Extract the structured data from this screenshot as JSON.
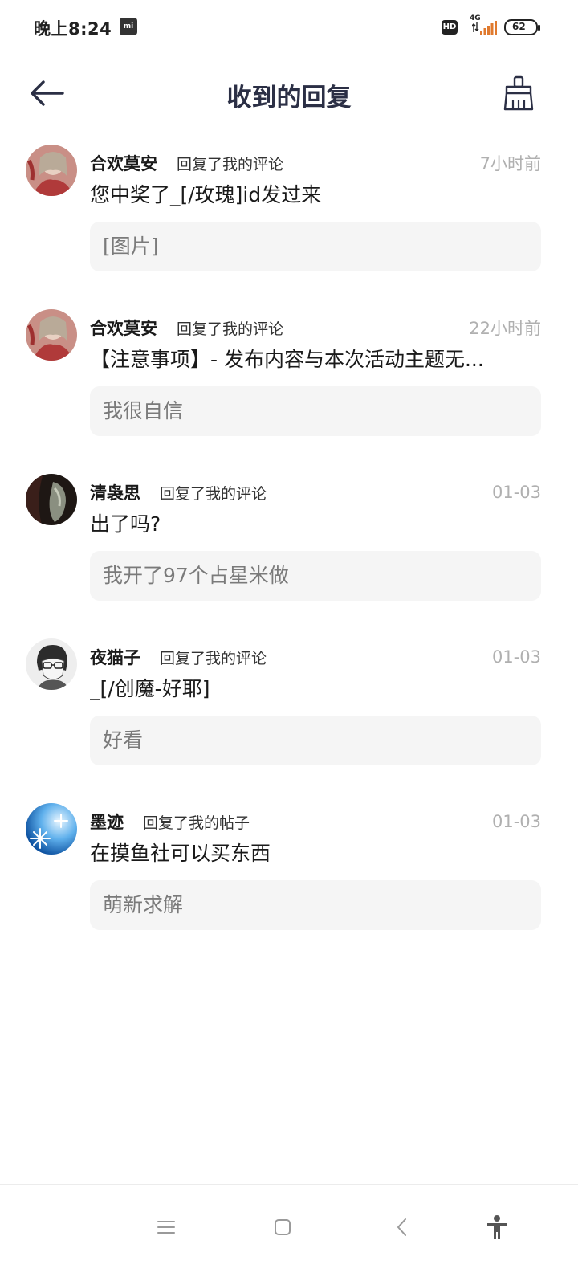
{
  "status_bar": {
    "time": "晚上8:24",
    "mi_badge": "mi",
    "hd_badge": "HD",
    "network": "4G",
    "battery": "62"
  },
  "header": {
    "title": "收到的回复",
    "back_icon": "arrow-left-icon",
    "clear_icon": "broom-icon"
  },
  "replies": [
    {
      "user": "合欢莫安",
      "action": "回复了我的评论",
      "time": "7小时前",
      "content": "您中奖了_[/玫瑰]id发过来",
      "quote": "[图片]",
      "avatar": "pink-portrait"
    },
    {
      "user": "合欢莫安",
      "action": "回复了我的评论",
      "time": "22小时前",
      "content": "【注意事项】- 发布内容与本次活动主题无...",
      "quote": "我很自信",
      "avatar": "pink-portrait"
    },
    {
      "user": "清袅思",
      "action": "回复了我的评论",
      "time": "01-03",
      "content": "出了吗?",
      "quote": "我开了97个占星米做",
      "avatar": "dark-portrait"
    },
    {
      "user": "夜猫子",
      "action": "回复了我的评论",
      "time": "01-03",
      "content": "_[/创魔-好耶]",
      "quote": "好看",
      "avatar": "sketch-portrait"
    },
    {
      "user": "墨迹",
      "action": "回复了我的帖子",
      "time": "01-03",
      "content": "在摸鱼社可以买东西",
      "quote": "萌新求解",
      "avatar": "snowflake-blue"
    }
  ],
  "nav": {
    "menu_icon": "menu-icon",
    "home_icon": "square-home-icon",
    "back_icon": "chevron-left-icon",
    "accessibility_icon": "accessibility-icon"
  }
}
